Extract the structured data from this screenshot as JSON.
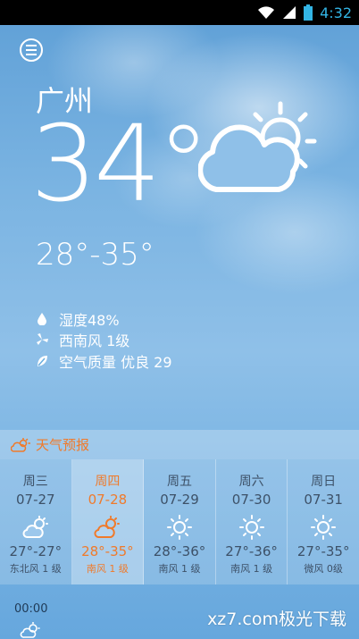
{
  "status_bar": {
    "time": "4:32"
  },
  "current": {
    "city": "广州",
    "temperature": "34°",
    "range": "28°-35°",
    "humidity": "湿度48%",
    "wind": "西南风 1级",
    "air_quality": "空气质量 优良 29"
  },
  "forecast": {
    "title": "天气预报",
    "days": [
      {
        "name": "周三",
        "date": "07-27",
        "range": "27°-27°",
        "wind": "东北风 1 级",
        "icon": "partly-cloudy-icon"
      },
      {
        "name": "周四",
        "date": "07-28",
        "range": "28°-35°",
        "wind": "南风 1 级",
        "icon": "partly-cloudy-icon"
      },
      {
        "name": "周五",
        "date": "07-29",
        "range": "28°-36°",
        "wind": "南风 1 级",
        "icon": "sun-icon"
      },
      {
        "name": "周六",
        "date": "07-30",
        "range": "27°-36°",
        "wind": "南风 1 级",
        "icon": "sun-icon"
      },
      {
        "name": "周日",
        "date": "07-31",
        "range": "27°-35°",
        "wind": "微风 0级",
        "icon": "sun-icon"
      }
    ]
  },
  "hourly": {
    "first_time": "00:00"
  },
  "watermark": "xz7.com极光下载",
  "colors": {
    "accent": "#f07a2a",
    "status_time": "#33b5e5"
  }
}
